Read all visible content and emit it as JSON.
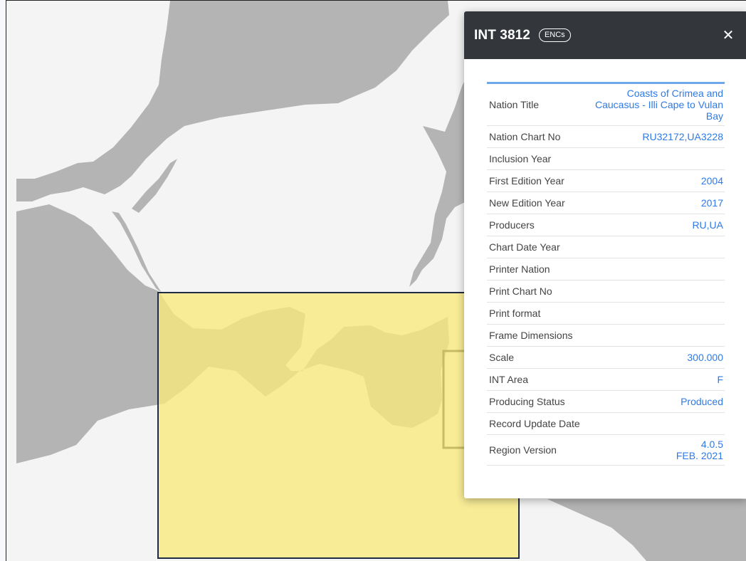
{
  "popup": {
    "title": "INT 3812",
    "badge": "ENCs",
    "close_symbol": "✕",
    "rows": [
      {
        "key": "Nation Title",
        "value": "Coasts of Crimea and Caucasus - Illi Cape to Vulan Bay"
      },
      {
        "key": "Nation Chart No",
        "value": "RU32172,UA3228"
      },
      {
        "key": "Inclusion Year",
        "value": ""
      },
      {
        "key": "First Edition Year",
        "value": "2004"
      },
      {
        "key": "New Edition Year",
        "value": "2017"
      },
      {
        "key": "Producers",
        "value": "RU,UA"
      },
      {
        "key": "Chart Date Year",
        "value": ""
      },
      {
        "key": "Printer Nation",
        "value": ""
      },
      {
        "key": "Print Chart No",
        "value": ""
      },
      {
        "key": "Print format",
        "value": ""
      },
      {
        "key": "Frame Dimensions",
        "value": ""
      },
      {
        "key": "Scale",
        "value": "300.000"
      },
      {
        "key": "INT Area",
        "value": "F"
      },
      {
        "key": "Producing Status",
        "value": "Produced"
      },
      {
        "key": "Record Update Date",
        "value": ""
      },
      {
        "key": "Region Version",
        "value": "4.0.5\nFEB. 2021"
      }
    ]
  },
  "colors": {
    "land": "#b4b4b4",
    "sea": "#f4f4f4",
    "chart_fill": "#f8e97b",
    "chart_border": "#1f2a44",
    "header": "#33373c",
    "value_text": "#2f7ae5"
  }
}
